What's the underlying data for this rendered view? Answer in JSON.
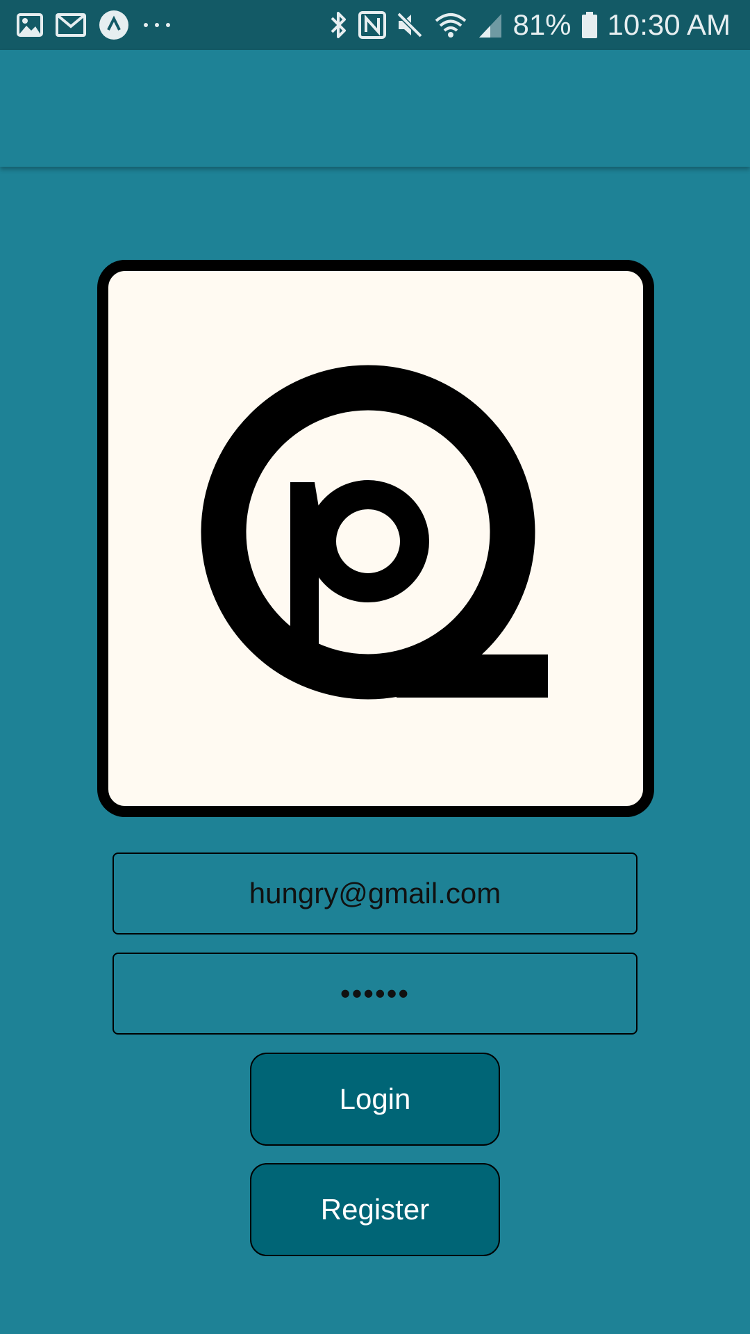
{
  "status_bar": {
    "battery": "81%",
    "time": "10:30 AM",
    "left_icons": [
      "gallery-icon",
      "gmail-icon",
      "app-notification-icon",
      "more-dots-icon"
    ],
    "right_icons": [
      "bluetooth-icon",
      "nfc-icon",
      "mute-icon",
      "wifi-icon",
      "signal-icon",
      "battery-icon"
    ]
  },
  "login_form": {
    "email_value": "hungry@gmail.com",
    "password_value": "••••••",
    "login_label": "Login",
    "register_label": "Register"
  },
  "colors": {
    "background": "#1e8296",
    "status_bar": "#135a66",
    "button": "#006576",
    "logo_background": "#fffaf2"
  }
}
